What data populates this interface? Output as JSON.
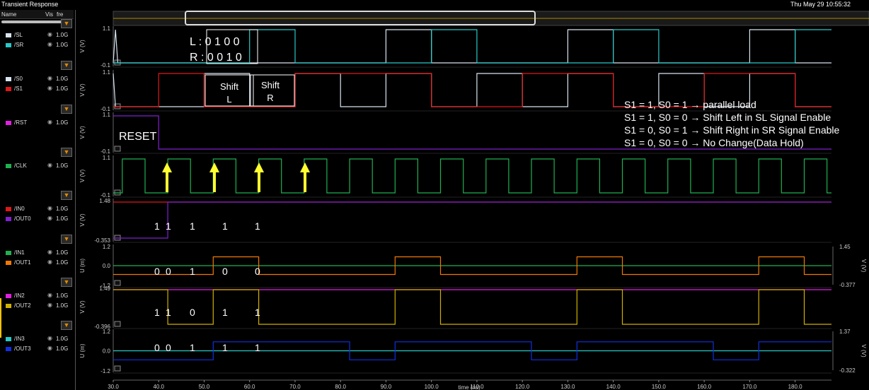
{
  "window": {
    "title": "Transient Response",
    "datetime": "Thu May 29 10:55:32"
  },
  "sidebar": {
    "columns": {
      "name": "Name",
      "vis": "Vis",
      "freq": "fre"
    },
    "signals": [
      {
        "name": "/SL",
        "freq": "1.0G",
        "color": "#d8e4f0"
      },
      {
        "name": "/SR",
        "freq": "1.0G",
        "color": "#28c8c8"
      },
      {
        "name": "/S0",
        "freq": "1.0G",
        "color": "#d8e4f0"
      },
      {
        "name": "/S1",
        "freq": "1.0G",
        "color": "#e01818"
      },
      {
        "name": "/RST",
        "freq": "1.0G",
        "color": "#e020e0"
      },
      {
        "name": "/CLK",
        "freq": "1.0G",
        "color": "#20b050"
      },
      {
        "name": "/IN0",
        "freq": "1.0G",
        "color": "#e01818"
      },
      {
        "name": "/OUT0",
        "freq": "1.0G",
        "color": "#8020d0"
      },
      {
        "name": "/IN1",
        "freq": "1.0G",
        "color": "#20b050"
      },
      {
        "name": "/OUT1",
        "freq": "1.0G",
        "color": "#f07800"
      },
      {
        "name": "/IN2",
        "freq": "1.0G",
        "color": "#e020e0"
      },
      {
        "name": "/OUT2",
        "freq": "1.0G",
        "color": "#d0b000"
      },
      {
        "name": "/IN3",
        "freq": "1.0G",
        "color": "#28c8c8"
      },
      {
        "name": "/OUT3",
        "freq": "1.0G",
        "color": "#1030e0"
      }
    ]
  },
  "chart_data": {
    "type": "line",
    "xlabel": "time (ns)",
    "xlim": [
      30,
      188
    ],
    "x_ticks": [
      "30.0",
      "40.0",
      "50.0",
      "60.0",
      "70.0",
      "80.0",
      "90.0",
      "100.0",
      "110.0",
      "120.0",
      "130.0",
      "140.0",
      "150.0",
      "160.0",
      "170.0",
      "180.0"
    ],
    "panels": [
      {
        "ylabel": "V (V)",
        "yticks": [
          "1.1",
          "-0.1"
        ],
        "series": [
          {
            "name": "/SL",
            "color": "#d8e4f0",
            "points": [
              [
                30,
                -0.1
              ],
              [
                30.5,
                1.1
              ],
              [
                31,
                -0.1
              ],
              [
                90,
                -0.1
              ],
              [
                90,
                1.1
              ],
              [
                100,
                1.1
              ],
              [
                100,
                -0.1
              ],
              [
                130,
                -0.1
              ],
              [
                130,
                1.1
              ],
              [
                140,
                1.1
              ],
              [
                140,
                -0.1
              ],
              [
                170,
                -0.1
              ],
              [
                170,
                1.1
              ],
              [
                180,
                1.1
              ],
              [
                180,
                -0.1
              ],
              [
                188,
                -0.1
              ]
            ]
          },
          {
            "name": "/SR",
            "color": "#28c8c8",
            "points": [
              [
                30,
                -0.1
              ],
              [
                60,
                -0.1
              ],
              [
                60,
                1.1
              ],
              [
                70,
                1.1
              ],
              [
                70,
                -0.1
              ],
              [
                100,
                -0.1
              ],
              [
                100,
                1.1
              ],
              [
                110,
                1.1
              ],
              [
                110,
                -0.1
              ],
              [
                140,
                -0.1
              ],
              [
                140,
                1.1
              ],
              [
                150,
                1.1
              ],
              [
                150,
                -0.1
              ],
              [
                180,
                -0.1
              ],
              [
                180,
                1.1
              ],
              [
                188,
                1.1
              ]
            ]
          }
        ]
      },
      {
        "ylabel": "V (V)",
        "yticks": [
          "1.1",
          "-0.1"
        ],
        "series": [
          {
            "name": "/S0",
            "color": "#d8e4f0",
            "points": [
              [
                30,
                1.1
              ],
              [
                30.5,
                -0.1
              ],
              [
                50,
                -0.1
              ],
              [
                50,
                1.1
              ],
              [
                60,
                1.1
              ],
              [
                60,
                -0.1
              ],
              [
                70,
                -0.1
              ],
              [
                70,
                1.1
              ],
              [
                80,
                1.1
              ],
              [
                80,
                -0.1
              ],
              [
                90,
                -0.1
              ],
              [
                90,
                1.1
              ],
              [
                100,
                1.1
              ],
              [
                100,
                -0.1
              ],
              [
                110,
                -0.1
              ],
              [
                110,
                1.1
              ],
              [
                120,
                1.1
              ],
              [
                120,
                -0.1
              ],
              [
                130,
                -0.1
              ],
              [
                130,
                1.1
              ],
              [
                140,
                1.1
              ],
              [
                140,
                -0.1
              ],
              [
                150,
                -0.1
              ],
              [
                150,
                1.1
              ],
              [
                160,
                1.1
              ],
              [
                160,
                -0.1
              ],
              [
                170,
                -0.1
              ],
              [
                170,
                1.1
              ],
              [
                180,
                1.1
              ],
              [
                180,
                -0.1
              ],
              [
                188,
                -0.1
              ]
            ]
          },
          {
            "name": "/S1",
            "color": "#e01818",
            "points": [
              [
                30,
                -0.1
              ],
              [
                40,
                -0.1
              ],
              [
                40,
                1.1
              ],
              [
                50,
                1.1
              ],
              [
                50,
                -0.1
              ],
              [
                70,
                -0.1
              ],
              [
                70,
                1.1
              ],
              [
                80,
                1.1
              ],
              [
                80,
                1.1
              ],
              [
                100,
                1.1
              ],
              [
                100,
                -0.1
              ],
              [
                120,
                -0.1
              ],
              [
                120,
                1.1
              ],
              [
                140,
                1.1
              ],
              [
                140,
                -0.1
              ],
              [
                160,
                -0.1
              ],
              [
                160,
                1.1
              ],
              [
                180,
                1.1
              ],
              [
                180,
                -0.1
              ],
              [
                188,
                -0.1
              ]
            ]
          }
        ]
      },
      {
        "ylabel": "V (V)",
        "yticks": [
          "1.1",
          "-0.1"
        ],
        "series": [
          {
            "name": "/RST",
            "color": "#8020d0",
            "points": [
              [
                30,
                1.1
              ],
              [
                40,
                1.1
              ],
              [
                40,
                -0.1
              ],
              [
                188,
                -0.1
              ]
            ]
          }
        ]
      },
      {
        "ylabel": "V (V)",
        "yticks": [
          "1.1",
          "-0.1"
        ],
        "series": [
          {
            "name": "/CLK",
            "color": "#20b050",
            "clock": {
              "period": 10,
              "high_start": 32,
              "duty": 0.5,
              "low": -0.1,
              "high": 1.1
            }
          }
        ]
      },
      {
        "ylabel": "V (V)",
        "yticks": [
          "1.48",
          "-0.353"
        ],
        "series": [
          {
            "name": "/IN0",
            "color": "#e01818",
            "points": [
              [
                30,
                1.1
              ],
              [
                188,
                1.1
              ]
            ]
          },
          {
            "name": "/OUT0",
            "color": "#8020d0",
            "points": [
              [
                30,
                -0.1
              ],
              [
                42,
                -0.1
              ],
              [
                42,
                1.1
              ],
              [
                188,
                1.1
              ]
            ]
          }
        ]
      },
      {
        "ylabel": "U (m)",
        "yticks": [
          "1.2",
          "0.0",
          "-1.2"
        ],
        "ylabel_right": "V (V)",
        "yticks_right": [
          "1.45",
          "-0.377"
        ],
        "series": [
          {
            "name": "/IN1",
            "color": "#20b050",
            "points": [
              [
                30,
                0.0
              ],
              [
                188,
                0.0
              ]
            ]
          },
          {
            "name": "/OUT1",
            "color": "#f07800",
            "points": [
              [
                30,
                -0.6
              ],
              [
                52,
                -0.6
              ],
              [
                52,
                0.6
              ],
              [
                62,
                0.6
              ],
              [
                62,
                -0.6
              ],
              [
                92,
                -0.6
              ],
              [
                92,
                0.6
              ],
              [
                102,
                0.6
              ],
              [
                102,
                -0.6
              ],
              [
                132,
                -0.6
              ],
              [
                132,
                0.6
              ],
              [
                142,
                0.6
              ],
              [
                142,
                -0.6
              ],
              [
                172,
                -0.6
              ],
              [
                172,
                0.6
              ],
              [
                182,
                0.6
              ],
              [
                182,
                -0.6
              ],
              [
                188,
                -0.6
              ]
            ]
          }
        ]
      },
      {
        "ylabel": "V (V)",
        "yticks": [
          "1.49",
          "-0.396"
        ],
        "series": [
          {
            "name": "/IN2",
            "color": "#e020e0",
            "points": [
              [
                30,
                1.1
              ],
              [
                188,
                1.1
              ]
            ]
          },
          {
            "name": "/OUT2",
            "color": "#d0b000",
            "points": [
              [
                30,
                1.1
              ],
              [
                42,
                1.1
              ],
              [
                42,
                -0.1
              ],
              [
                52,
                -0.1
              ],
              [
                52,
                1.1
              ],
              [
                62,
                1.1
              ],
              [
                62,
                -0.1
              ],
              [
                92,
                -0.1
              ],
              [
                92,
                1.1
              ],
              [
                102,
                1.1
              ],
              [
                102,
                -0.1
              ],
              [
                132,
                -0.1
              ],
              [
                132,
                1.1
              ],
              [
                142,
                1.1
              ],
              [
                142,
                -0.1
              ],
              [
                172,
                -0.1
              ],
              [
                172,
                1.1
              ],
              [
                182,
                1.1
              ],
              [
                182,
                -0.1
              ],
              [
                188,
                -0.1
              ]
            ]
          }
        ]
      },
      {
        "ylabel": "U (m)",
        "yticks": [
          "1.2",
          "0.0",
          "-1.2"
        ],
        "ylabel_right": "V (V)",
        "yticks_right": [
          "1.37",
          "-0.322"
        ],
        "series": [
          {
            "name": "/IN3",
            "color": "#28c8c8",
            "points": [
              [
                30,
                0.0
              ],
              [
                188,
                0.0
              ]
            ]
          },
          {
            "name": "/OUT3",
            "color": "#1030e0",
            "points": [
              [
                30,
                -0.6
              ],
              [
                52,
                -0.6
              ],
              [
                52,
                0.6
              ],
              [
                82,
                0.6
              ],
              [
                82,
                -0.6
              ],
              [
                92,
                -0.6
              ],
              [
                92,
                0.6
              ],
              [
                122,
                0.6
              ],
              [
                122,
                -0.6
              ],
              [
                132,
                -0.6
              ],
              [
                132,
                0.6
              ],
              [
                162,
                0.6
              ],
              [
                162,
                -0.6
              ],
              [
                172,
                -0.6
              ],
              [
                172,
                0.6
              ],
              [
                188,
                0.6
              ]
            ]
          }
        ]
      }
    ],
    "annotations": {
      "L": "L :  0    1      0     0",
      "R": "R :  0    0      1     0",
      "shiftL": [
        "Shift",
        "L"
      ],
      "shiftR": [
        "Shift",
        "R"
      ],
      "reset": "RESET",
      "legend": [
        "S1 = 1, S0 = 1 → parallel load",
        "S1 = 1, S0 = 0 → Shift Left in SL Signal Enable",
        "S1 = 0, S0 = 1 → Shift Right in SR Signal Enable",
        "S1 = 0, S0 = 0 → No Change(Data Hold)"
      ],
      "out0_bits": [
        "1",
        "1",
        "1",
        "1",
        "1"
      ],
      "out1_bits": [
        "0",
        "0",
        "1",
        "0",
        "0"
      ],
      "out2_bits": [
        "1",
        "1",
        "0",
        "1",
        "1"
      ],
      "out3_bits": [
        "0",
        "0",
        "1",
        "1",
        "1"
      ]
    }
  }
}
